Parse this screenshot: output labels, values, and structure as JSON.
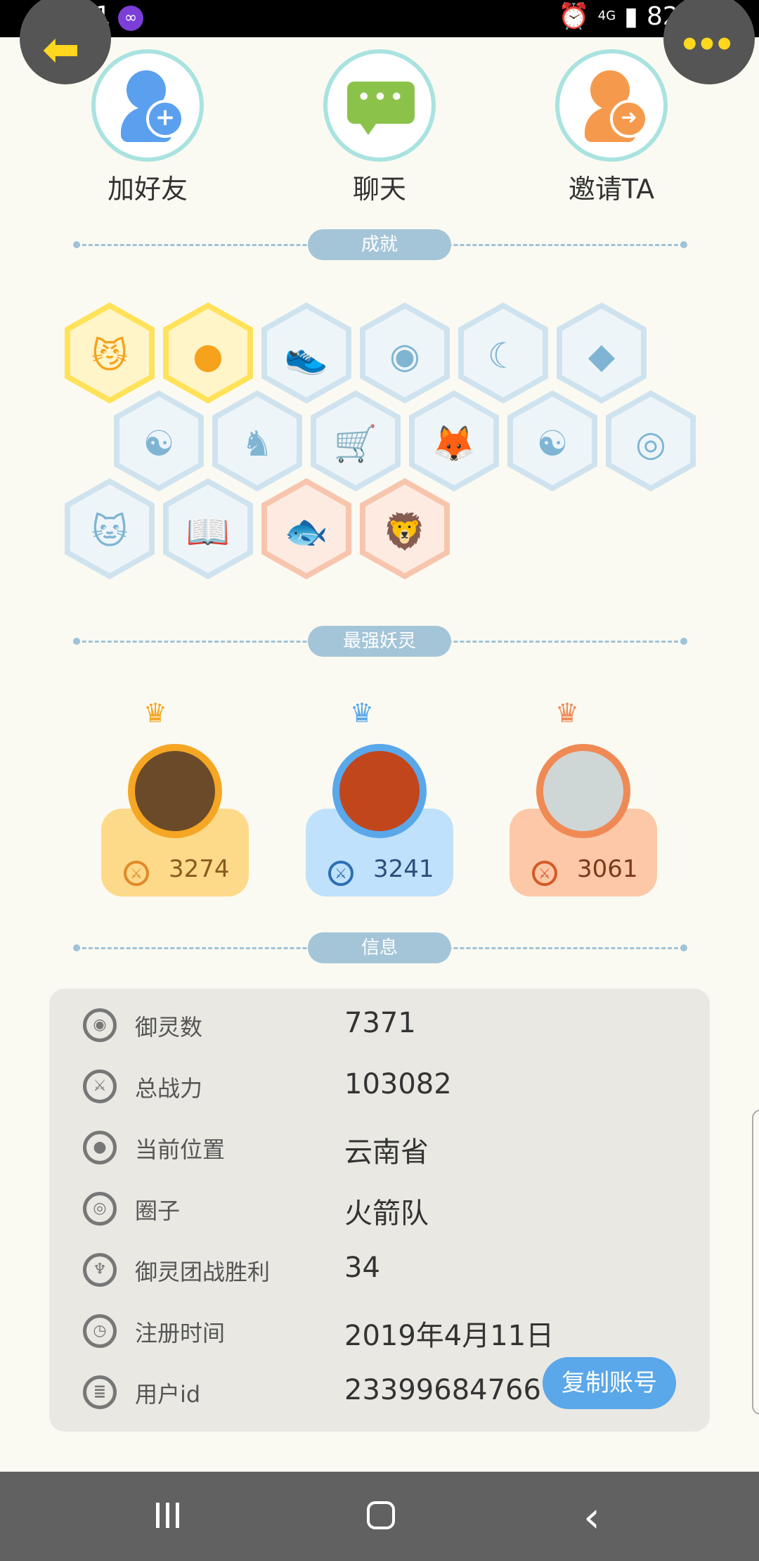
{
  "status_bar": {
    "time": "13:51",
    "network": "4G",
    "battery": "82%"
  },
  "actions": {
    "add_friend": "加好友",
    "chat": "聊天",
    "invite": "邀请TA"
  },
  "sections": {
    "achievements": "成就",
    "strongest": "最强妖灵",
    "info": "信息"
  },
  "achievements": [
    {
      "icon": "cat-face-icon",
      "tier": "gold"
    },
    {
      "icon": "gold-orb-icon",
      "tier": "gold"
    },
    {
      "icon": "sneaker-icon",
      "tier": "blue"
    },
    {
      "icon": "portal-icon",
      "tier": "blue"
    },
    {
      "icon": "moon-icon",
      "tier": "blue"
    },
    {
      "icon": "crystal-icon",
      "tier": "blue"
    },
    {
      "icon": "yin-yang-wave-icon",
      "tier": "blue"
    },
    {
      "icon": "spirit-figure-icon",
      "tier": "blue"
    },
    {
      "icon": "stroller-icon",
      "tier": "blue"
    },
    {
      "icon": "fox-spirit-icon",
      "tier": "blue"
    },
    {
      "icon": "yin-yang-box-icon",
      "tier": "blue"
    },
    {
      "icon": "scroll-frame-icon",
      "tier": "blue"
    },
    {
      "icon": "cat-statue-icon",
      "tier": "blue"
    },
    {
      "icon": "book-cat-icon",
      "tier": "blue"
    },
    {
      "icon": "koi-icon",
      "tier": "peach"
    },
    {
      "icon": "lion-statue-icon",
      "tier": "peach"
    }
  ],
  "spirits": [
    {
      "value": "3274",
      "color": "#fdd98a",
      "border": "#f5a623"
    },
    {
      "value": "3241",
      "color": "#bfe1fb",
      "border": "#5aa7ea"
    },
    {
      "value": "3061",
      "color": "#fcc8a8",
      "border": "#ef8a55"
    }
  ],
  "info": {
    "rows": [
      {
        "label": "御灵数",
        "value": "7371",
        "icon": "spirit-count-icon"
      },
      {
        "label": "总战力",
        "value": "103082",
        "icon": "sword-icon"
      },
      {
        "label": "当前位置",
        "value": "云南省",
        "icon": "location-pin-icon"
      },
      {
        "label": "圈子",
        "value": "火箭队",
        "icon": "circle-target-icon"
      },
      {
        "label": "御灵团战胜利",
        "value": "34",
        "icon": "team-win-icon"
      },
      {
        "label": "注册时间",
        "value": "2019年4月11日",
        "icon": "clock-icon"
      },
      {
        "label": "用户id",
        "value": "23399684766",
        "icon": "id-card-icon"
      }
    ],
    "copy_button": "复制账号"
  }
}
